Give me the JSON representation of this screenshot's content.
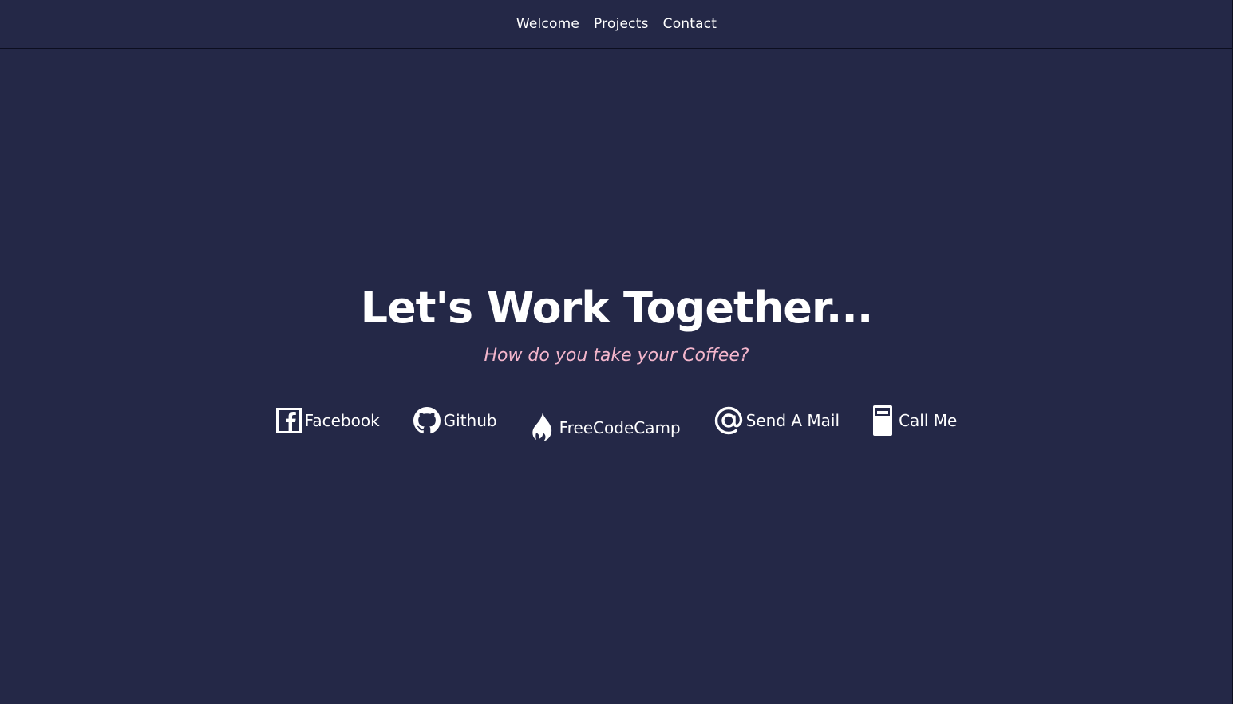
{
  "nav": {
    "items": [
      {
        "label": "Welcome"
      },
      {
        "label": "Projects"
      },
      {
        "label": "Contact"
      }
    ]
  },
  "contact": {
    "headline": "Let's Work Together...",
    "tagline": "How do you take your Coffee?"
  },
  "links": [
    {
      "label": "Facebook",
      "icon": "facebook-icon"
    },
    {
      "label": "Github",
      "icon": "github-icon"
    },
    {
      "label": "FreeCodeCamp",
      "icon": "fire-icon"
    },
    {
      "label": "Send A Mail",
      "icon": "at-icon"
    },
    {
      "label": "Call Me",
      "icon": "mobile-phone-icon"
    }
  ],
  "colors": {
    "background": "#242847",
    "accent": "#f4b6cc",
    "text": "#ffffff"
  }
}
